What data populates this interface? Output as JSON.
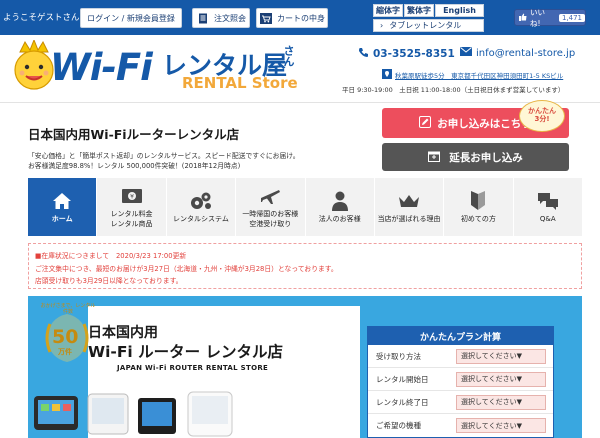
{
  "topbar": {
    "welcome": "ようこそゲストさん",
    "login_label": "ログイン / 新規会員登録",
    "order_label": "注文照会",
    "cart_label": "カートの中身",
    "font_small": "縮体字",
    "font_large": "繁体字",
    "english": "English",
    "tablet_link": "タブレットレンタル",
    "like_label": "いいね!",
    "like_count": "1,471"
  },
  "header": {
    "logo_main": "Wi-Fi",
    "logo_rental": "レンタル屋",
    "logo_san": "さん",
    "logo_en": "RENTAL Store",
    "phone": "03-3525-8351",
    "email": "info@rental-store.jp",
    "address": "秋葉原駅徒歩5分　東京都千代田区神田須田町1-5 KSビル",
    "hours": "平日 9:30-19:00　土日祝 11:00-18:00（土日祝日休まず営業しています）"
  },
  "intro": {
    "headline": "日本国内用Wi-Fiルーターレンタル店",
    "line1": "「安心価格」と「簡単ポスト返却」のレンタルサービス。スピード配送ですぐにお届け。",
    "line2": "お客様満足度98.8%！レンタル 500,000件突破！(2018年12月時点)",
    "apply_label": "お申し込みはこちら",
    "bubble_line1": "かんたん",
    "bubble_line2": "3分!",
    "extend_label": "延長お申し込み"
  },
  "nav": [
    {
      "label": "ホーム",
      "icon": "home-icon",
      "active": true
    },
    {
      "label": "レンタル料金\nレンタル商品",
      "icon": "yen-bill-icon",
      "active": false
    },
    {
      "label": "レンタルシステム",
      "icon": "gears-icon",
      "active": false
    },
    {
      "label": "一時帰国のお客様\n空港受け取り",
      "icon": "airplane-icon",
      "active": false
    },
    {
      "label": "法人のお客様",
      "icon": "person-icon",
      "active": false
    },
    {
      "label": "当店が選ばれる理由",
      "icon": "crown-icon",
      "active": false
    },
    {
      "label": "初めての方",
      "icon": "beginner-icon",
      "active": false
    },
    {
      "label": "Q&A",
      "icon": "qa-icon",
      "active": false
    }
  ],
  "notice": {
    "line1": "■在庫状況につきまして　2020/3/23 17:00更新",
    "line2": "ご注文集中につき、最短のお届けが3月27日（北海道・九州・沖縄が3月28日）となっております。",
    "line3": "店頭受け取りも3月29日以降となっております。"
  },
  "hero": {
    "badge_top": "おかげさまで、レンタル件数",
    "badge_num": "50",
    "badge_unit": "万件",
    "title1": "日本国内用",
    "title2": "Wi-Fi ルーター レンタル店",
    "subtitle": "JAPAN Wi-Fi ROUTER RENTAL STORE"
  },
  "calc": {
    "title": "かんたんプラン計算",
    "rows": [
      {
        "label": "受け取り方法",
        "value": "選択してください▼"
      },
      {
        "label": "レンタル開始日",
        "value": "選択してください▼"
      },
      {
        "label": "レンタル終了日",
        "value": "選択してください▼"
      },
      {
        "label": "ご希望の機種",
        "value": "選択してください▼"
      }
    ]
  },
  "colors": {
    "brand_blue": "#1559a8",
    "apply_red": "#ed4e5d",
    "hero_sky": "#39a7e0"
  }
}
